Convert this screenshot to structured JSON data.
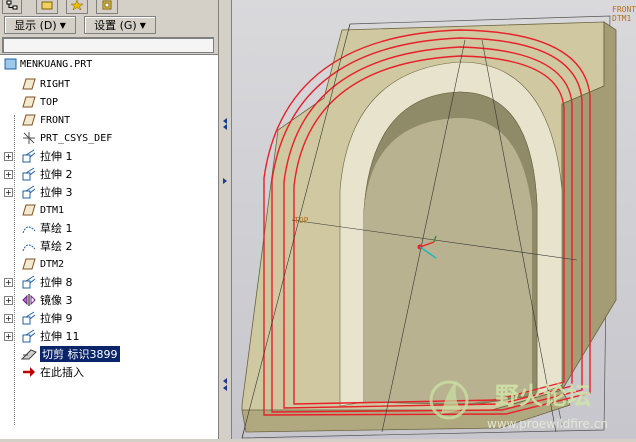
{
  "toolbar": {
    "show_label": "显示 (D)",
    "settings_label": "设置 (G)"
  },
  "tree": {
    "root": "MENKUANG.PRT",
    "items": [
      {
        "label": "RIGHT",
        "icon": "datum-plane-icon",
        "expand": false
      },
      {
        "label": "TOP",
        "icon": "datum-plane-icon",
        "expand": false
      },
      {
        "label": "FRONT",
        "icon": "datum-plane-icon",
        "expand": false
      },
      {
        "label": "PRT_CSYS_DEF",
        "icon": "csys-icon",
        "expand": false
      },
      {
        "label": "拉伸 1",
        "icon": "extrude-icon",
        "expand": true
      },
      {
        "label": "拉伸 2",
        "icon": "extrude-icon",
        "expand": true
      },
      {
        "label": "拉伸 3",
        "icon": "extrude-icon",
        "expand": true
      },
      {
        "label": "DTM1",
        "icon": "datum-plane-icon",
        "expand": false
      },
      {
        "label": "草绘 1",
        "icon": "sketch-icon",
        "expand": false
      },
      {
        "label": "草绘 2",
        "icon": "sketch-icon",
        "expand": false
      },
      {
        "label": "DTM2",
        "icon": "datum-plane-icon",
        "expand": false
      },
      {
        "label": "拉伸 8",
        "icon": "extrude-icon",
        "expand": true
      },
      {
        "label": "镜像 3",
        "icon": "mirror-icon",
        "expand": true
      },
      {
        "label": "拉伸 9",
        "icon": "extrude-icon",
        "expand": true
      },
      {
        "label": "拉伸 11",
        "icon": "extrude-icon",
        "expand": true
      },
      {
        "label": "切剪 标识3899",
        "icon": "cut-icon",
        "expand": false,
        "selected": true
      },
      {
        "label": "在此插入",
        "icon": "insert-here-icon",
        "expand": false
      }
    ]
  },
  "viewport": {
    "corner_labels": [
      "FRONT",
      "DTM1"
    ],
    "datum_labels": [
      "TOP"
    ]
  },
  "watermark": {
    "title": "野火论坛",
    "url": "www.proewildfire.cn"
  },
  "colors": {
    "panel": "#d4d0c8",
    "selection": "#0a246a",
    "model_face": "#c8c29a",
    "highlight": "#e8202a"
  }
}
